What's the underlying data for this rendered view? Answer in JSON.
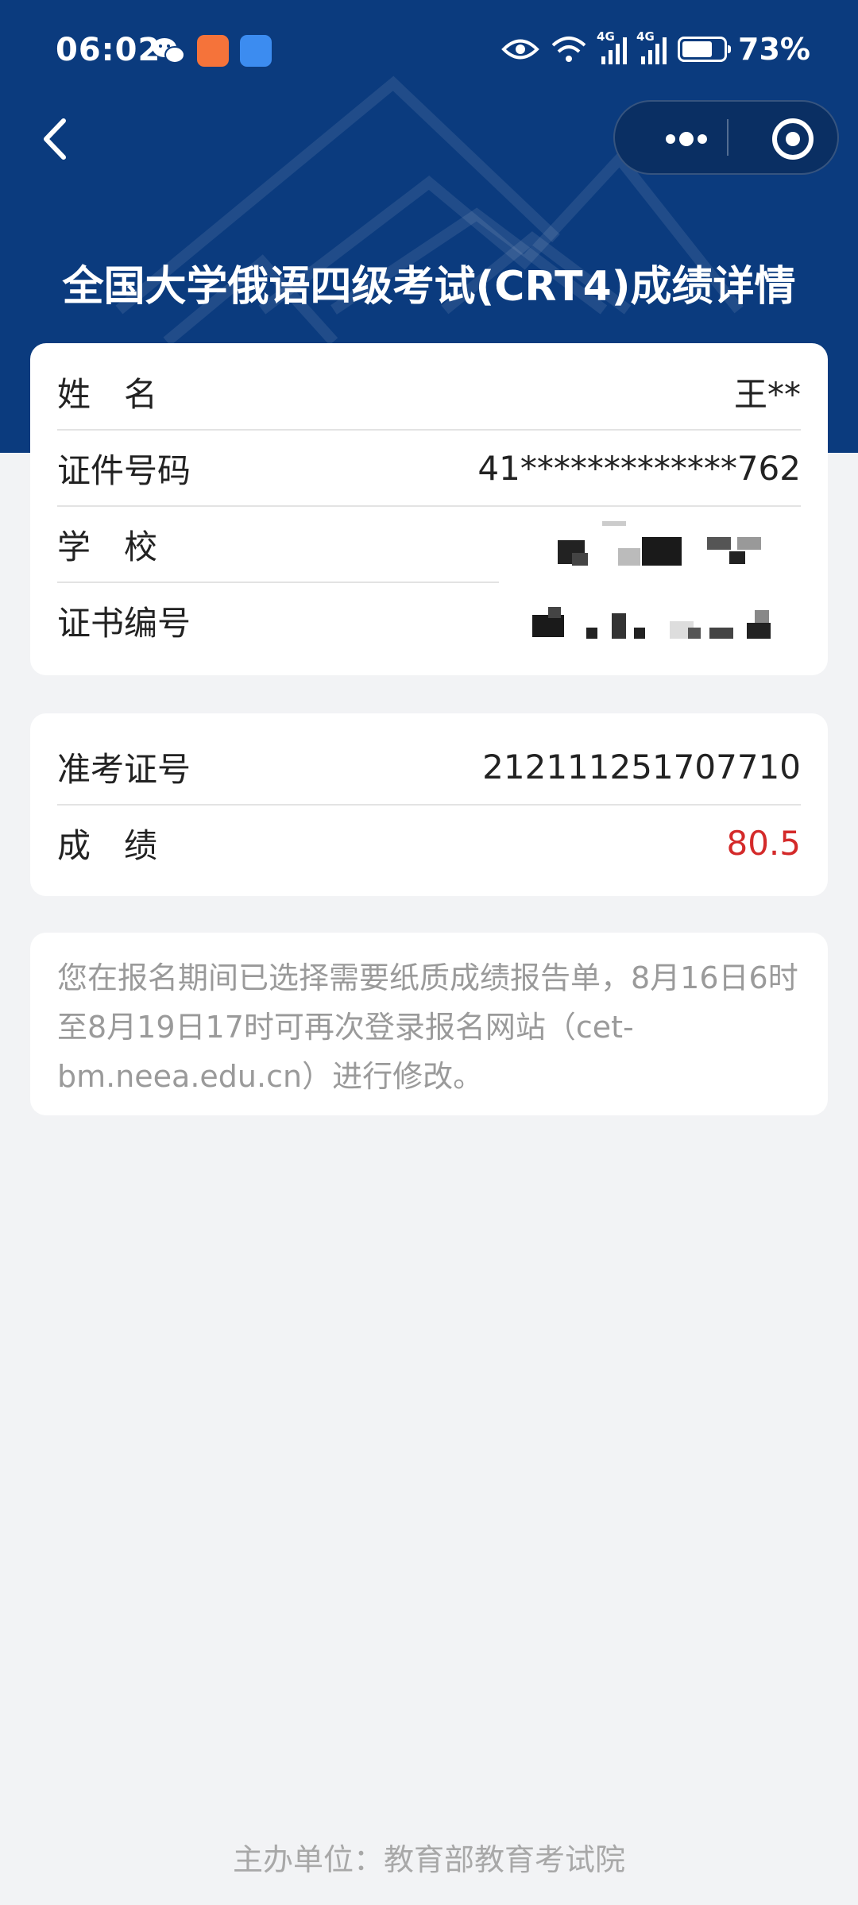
{
  "status_bar": {
    "time": "06:02",
    "battery": "73%",
    "battery_level": 0.73,
    "network_1": "4G",
    "network_2": "4G"
  },
  "page": {
    "title": "全国大学俄语四级考试(CRT4)成绩详情"
  },
  "personal_info": {
    "name_label": "姓　名",
    "name_value": "王**",
    "id_label": "证件号码",
    "id_value": "41*************762",
    "school_label": "学　校",
    "certificate_label": "证书编号"
  },
  "score_info": {
    "exam_no_label": "准考证号",
    "exam_no_value": "212111251707710",
    "score_label": "成　绩",
    "score_value": "80.5"
  },
  "notice": {
    "text": "您在报名期间已选择需要纸质成绩报告单，8月16日6时至8月19日17时可再次登录报名网站（cet-bm.neea.edu.cn）进行修改。"
  },
  "footer": {
    "text": "主办单位：教育部教育考试院"
  },
  "colors": {
    "header_bg": "#0b3b7e",
    "score_red": "#d42a2a",
    "page_bg": "#f2f3f5"
  },
  "icons": {
    "wechat": "wechat-icon",
    "eye": "eye-icon",
    "wifi": "wifi-icon",
    "back": "chevron-left-icon",
    "more": "more-dots-icon",
    "close": "target-icon"
  }
}
